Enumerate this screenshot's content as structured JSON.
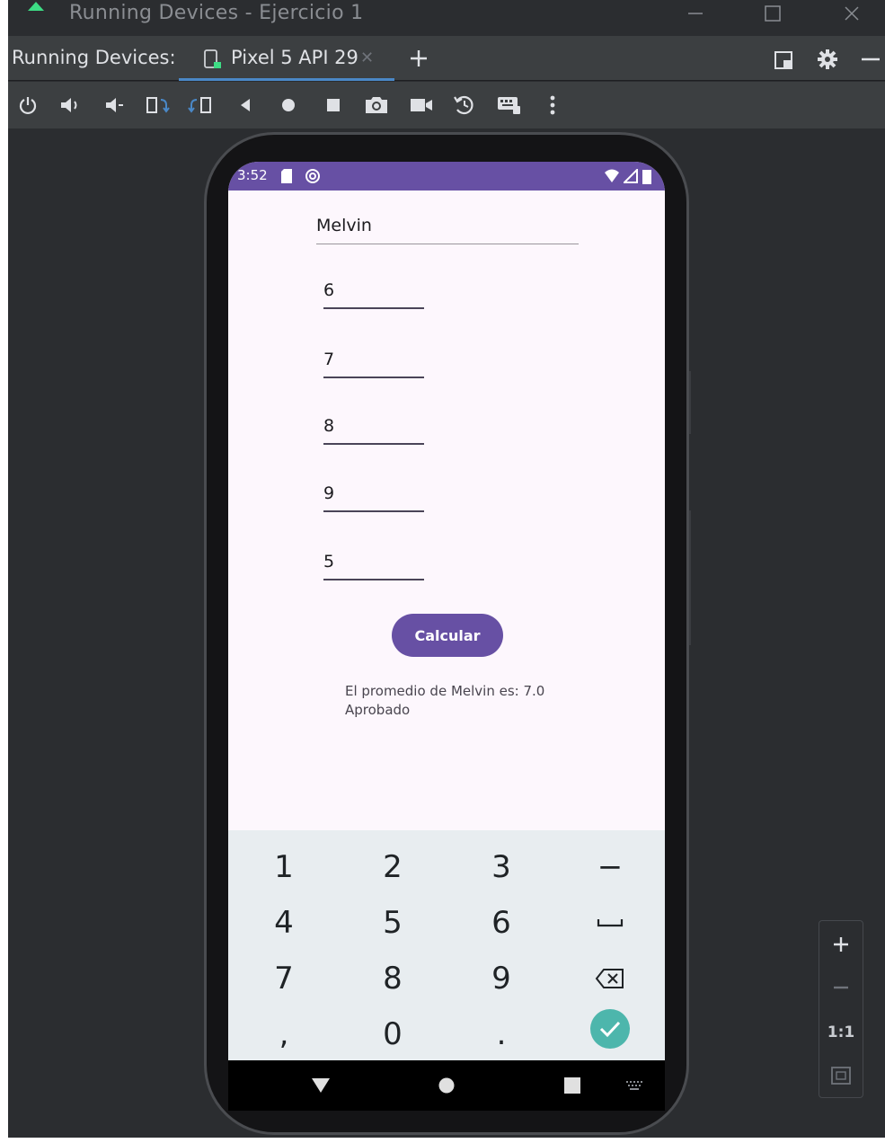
{
  "window": {
    "title": "Running Devices - Ejercicio 1"
  },
  "tabs": {
    "label": "Running Devices:",
    "device_tab": "Pixel 5 API 29"
  },
  "status_bar": {
    "time": "3:52"
  },
  "form": {
    "name": "Melvin",
    "grades": [
      "6",
      "7",
      "8",
      "9",
      "5"
    ],
    "calc_button": "Calcular",
    "result_line1": "El promedio de Melvin es: 7.0",
    "result_line2": "Aprobado"
  },
  "keyboard": {
    "rows": [
      [
        "1",
        "2",
        "3",
        "−"
      ],
      [
        "4",
        "5",
        "6",
        "space-icon"
      ],
      [
        "7",
        "8",
        "9",
        "backspace-icon"
      ],
      [
        ",",
        "0",
        ".",
        "done-icon"
      ]
    ]
  },
  "zoom": {
    "one_to_one": "1:1"
  },
  "colors": {
    "primary": "#6750a4",
    "done_key": "#4db6ac",
    "tab_underline": "#4a88c7"
  }
}
